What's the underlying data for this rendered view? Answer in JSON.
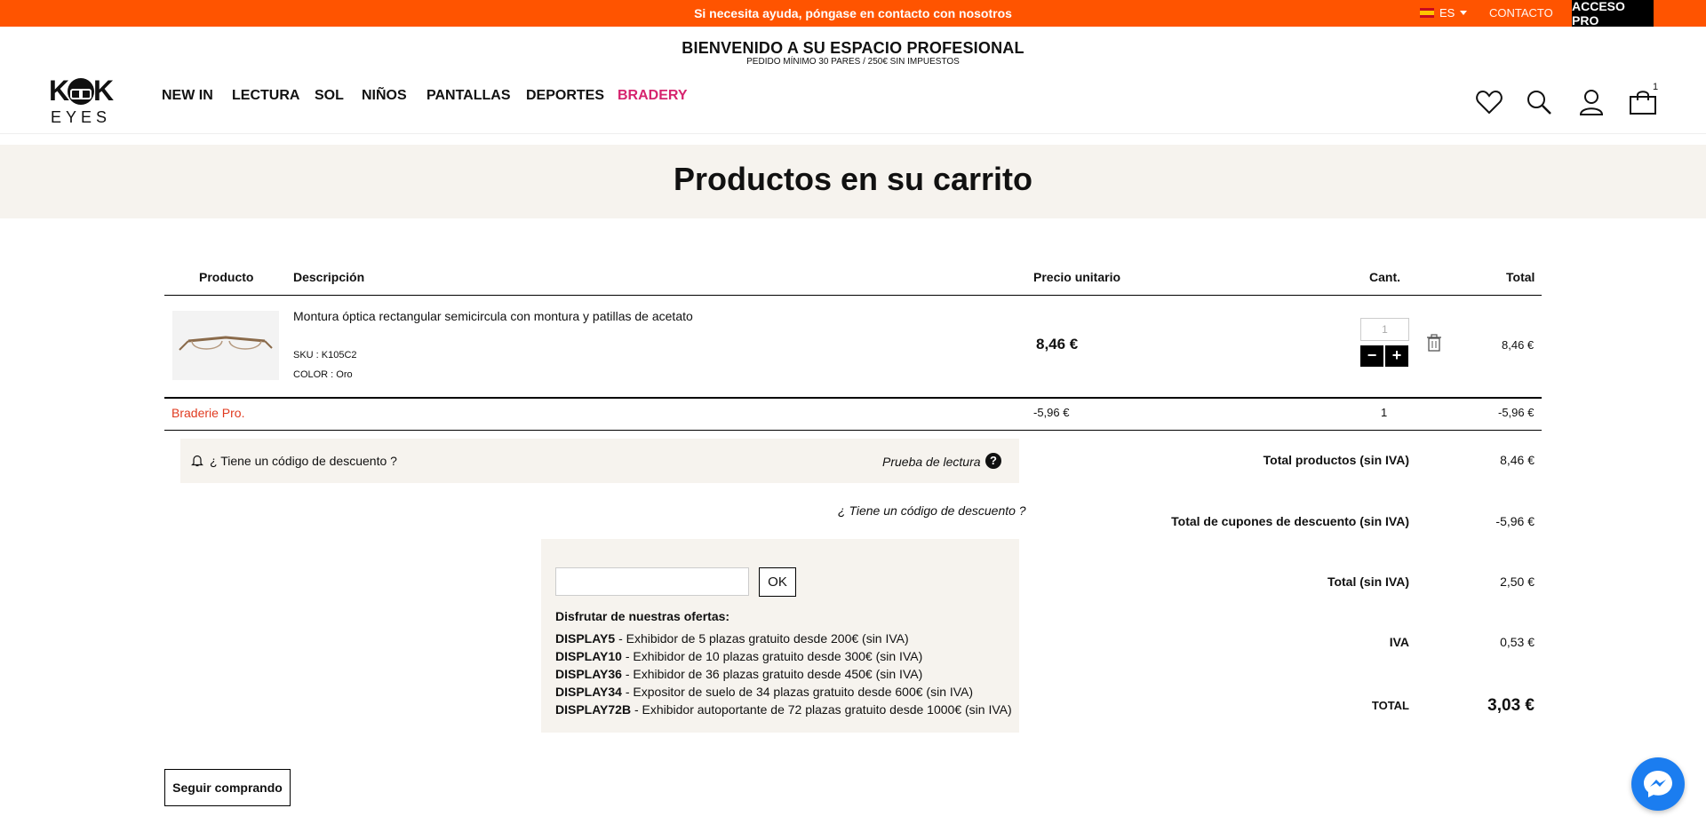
{
  "topbar": {
    "help": "Si necesita ayuda, póngase en contacto con nosotros",
    "lang": "ES",
    "contact": "CONTACTO",
    "pro": "ACCESO PRO",
    "accent_color": "#ff5400"
  },
  "header": {
    "welcome": "BIENVENIDO A SU ESPACIO PROFESIONAL",
    "min_order": "PEDIDO MÍNIMO 30 PARES / 250€ SIN IMPUESTOS",
    "logo_top": "K  K",
    "logo_bottom": "EYES",
    "nav": [
      "NEW IN",
      "LECTURA",
      "SOL",
      "NIÑOS",
      "PANTALLAS",
      "DEPORTES",
      "BRADERY"
    ],
    "cart_count": "1"
  },
  "banner": {
    "title": "Productos en su carrito"
  },
  "table": {
    "headers": {
      "product": "Producto",
      "description": "Descripción",
      "unit_price": "Precio unitario",
      "qty": "Cant.",
      "total": "Total"
    },
    "item": {
      "description": "Montura óptica rectangular semicircula con montura y patillas de acetato",
      "sku": "SKU : K105C2",
      "color": "COLOR : Oro",
      "unit_price": "8,46 €",
      "qty": "1",
      "total": "8,46 €"
    },
    "discount_row": {
      "label": "Braderie Pro.",
      "price": "-5,96 €",
      "qty": "1",
      "total": "-5,96 €"
    }
  },
  "coupon": {
    "question": "¿ Tiene un código de descuento ?",
    "reading_test": "Prueba de lectura",
    "question2": "¿ Tiene un código de descuento ?",
    "input_value": "",
    "ok": "OK",
    "offers_title": "Disfrutar de nuestras ofertas:",
    "offers": [
      {
        "code": "DISPLAY5",
        "text": " - Exhibidor de 5 plazas gratuito desde 200€ (sin IVA)"
      },
      {
        "code": "DISPLAY10",
        "text": " - Exhibidor de 10 plazas gratuito desde 300€ (sin IVA)"
      },
      {
        "code": "DISPLAY36",
        "text": " - Exhibidor de 36 plazas gratuito desde 450€ (sin IVA)"
      },
      {
        "code": "DISPLAY34",
        "text": " - Expositor de suelo de 34 plazas gratuito desde 600€ (sin IVA)"
      },
      {
        "code": "DISPLAY72B",
        "text": " - Exhibidor autoportante de 72 plazas gratuito desde 1000€ (sin IVA)"
      }
    ]
  },
  "totals": {
    "products_label": "Total productos (sin IVA)",
    "products": "8,46 €",
    "coupons_label": "Total de cupones de descuento (sin IVA)",
    "coupons": "-5,96 €",
    "net_label": "Total (sin IVA)",
    "net": "2,50 €",
    "vat_label": "IVA",
    "vat": "0,53 €",
    "total_label": "TOTAL",
    "total": "3,03 €"
  },
  "actions": {
    "continue": "Seguir comprando"
  }
}
